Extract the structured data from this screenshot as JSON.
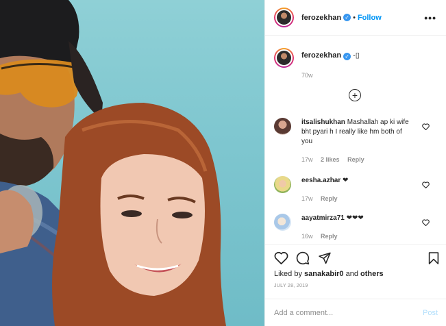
{
  "post": {
    "username": "ferozekhan",
    "follow_sep": "•",
    "follow_label": "Follow",
    "more_label": "•••",
    "caption": {
      "username": "ferozekhan",
      "text": "-▯",
      "age": "70w"
    },
    "load_more_label": "+",
    "comments": [
      {
        "username": "itsalishukhan",
        "text": "Mashallah ap ki wife bht pyari h I really like hm both of you",
        "age": "17w",
        "likes": "2 likes",
        "reply": "Reply"
      },
      {
        "username": "eesha.azhar",
        "text": "❤",
        "age": "17w",
        "reply": "Reply"
      },
      {
        "username": "aayatmirza71",
        "text": "❤❤❤",
        "age": "16w",
        "reply": "Reply"
      }
    ],
    "liked_by_prefix": "Liked by",
    "liked_by_user": "sanakabir0",
    "liked_by_and": "and",
    "liked_by_others": "others",
    "date": "JULY 28, 2019",
    "add_comment_placeholder": "Add a comment...",
    "post_label": "Post"
  },
  "icons": {
    "verified": "✓",
    "like": "heart-icon",
    "comment": "comment-icon",
    "share": "share-icon",
    "save": "bookmark-icon"
  },
  "colors": {
    "link_blue": "#0095f6",
    "verified_blue": "#3897f0",
    "muted_text": "#8e8e8e",
    "post_disabled": "#b2dffc"
  }
}
